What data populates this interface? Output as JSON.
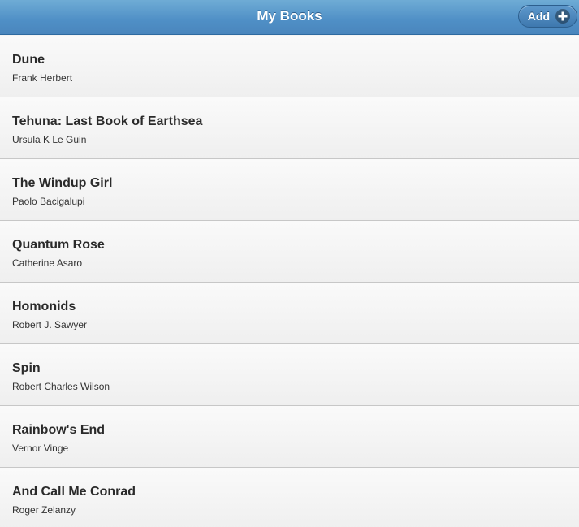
{
  "header": {
    "title": "My Books",
    "add_label": "Add",
    "add_icon": "plus-circle-icon"
  },
  "colors": {
    "header_bar": "#5a9ad0",
    "list_background": "#f4f4f4",
    "divider": "#c7c7c7"
  },
  "books": [
    {
      "title": "Dune",
      "author": "Frank Herbert"
    },
    {
      "title": "Tehuna: Last Book of Earthsea",
      "author": "Ursula K Le Guin"
    },
    {
      "title": "The Windup Girl",
      "author": "Paolo Bacigalupi"
    },
    {
      "title": "Quantum Rose",
      "author": "Catherine Asaro"
    },
    {
      "title": "Homonids",
      "author": "Robert J. Sawyer"
    },
    {
      "title": "Spin",
      "author": "Robert Charles Wilson"
    },
    {
      "title": "Rainbow's End",
      "author": "Vernor Vinge"
    },
    {
      "title": "And Call Me Conrad",
      "author": "Roger Zelanzy"
    }
  ]
}
